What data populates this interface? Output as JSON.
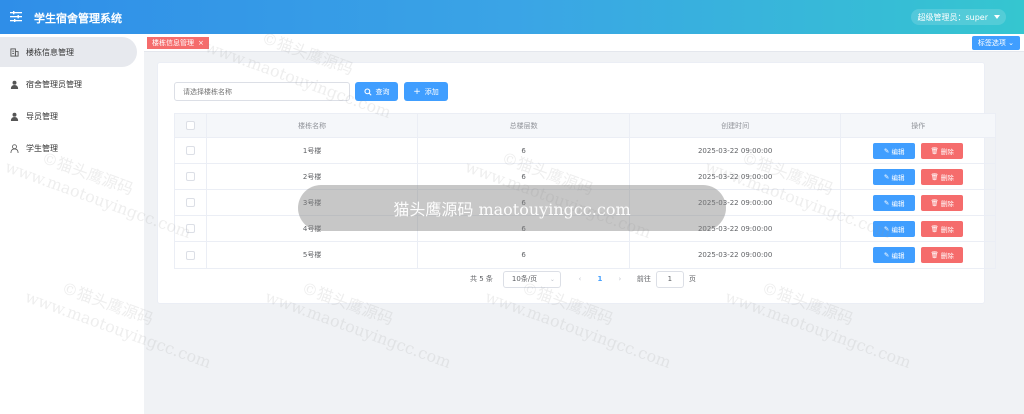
{
  "header": {
    "title": "学生宿舍管理系统",
    "user": "超级管理员：super",
    "menu_icon": "menu-toggle-icon"
  },
  "sidebar": {
    "items": [
      {
        "label": "楼栋信息管理",
        "icon": "building-icon",
        "active": true
      },
      {
        "label": "宿舍管理员管理",
        "icon": "user-icon",
        "active": false
      },
      {
        "label": "导员管理",
        "icon": "user-icon",
        "active": false
      },
      {
        "label": "学生管理",
        "icon": "user-outline-icon",
        "active": false
      }
    ]
  },
  "tabs": {
    "active_tag": "楼栋信息管理",
    "options_label": "标签选项"
  },
  "toolbar": {
    "search_placeholder": "请选择楼栋名称",
    "search_label": "查询",
    "add_label": "添加"
  },
  "table": {
    "columns": [
      "楼栋名称",
      "总楼层数",
      "创建时间",
      "操作"
    ],
    "rows": [
      {
        "name": "1号楼",
        "floors": "6",
        "created": "2025-03-22 09:00:00"
      },
      {
        "name": "2号楼",
        "floors": "6",
        "created": "2025-03-22 09:00:00"
      },
      {
        "name": "3号楼",
        "floors": "6",
        "created": "2025-03-22 09:00:00"
      },
      {
        "name": "4号楼",
        "floors": "6",
        "created": "2025-03-22 09:00:00"
      },
      {
        "name": "5号楼",
        "floors": "6",
        "created": "2025-03-22 09:00:00"
      }
    ],
    "edit_label": "编辑",
    "delete_label": "删除"
  },
  "pagination": {
    "total": "共 5 条",
    "page_size": "10条/页",
    "current_page": "1",
    "goto_prefix": "前往",
    "goto_value": "1",
    "goto_suffix": "页"
  },
  "overlay": {
    "text": "猫头鹰源码 maotouyingcc.com"
  },
  "watermark": {
    "text_cn": "©猫头鹰源码",
    "text_en": "www.maotouyingcc.com"
  },
  "colors": {
    "primary": "#409eff",
    "danger": "#f56c6c",
    "header_start": "#2f8ee8",
    "header_end": "#35c6d0"
  }
}
